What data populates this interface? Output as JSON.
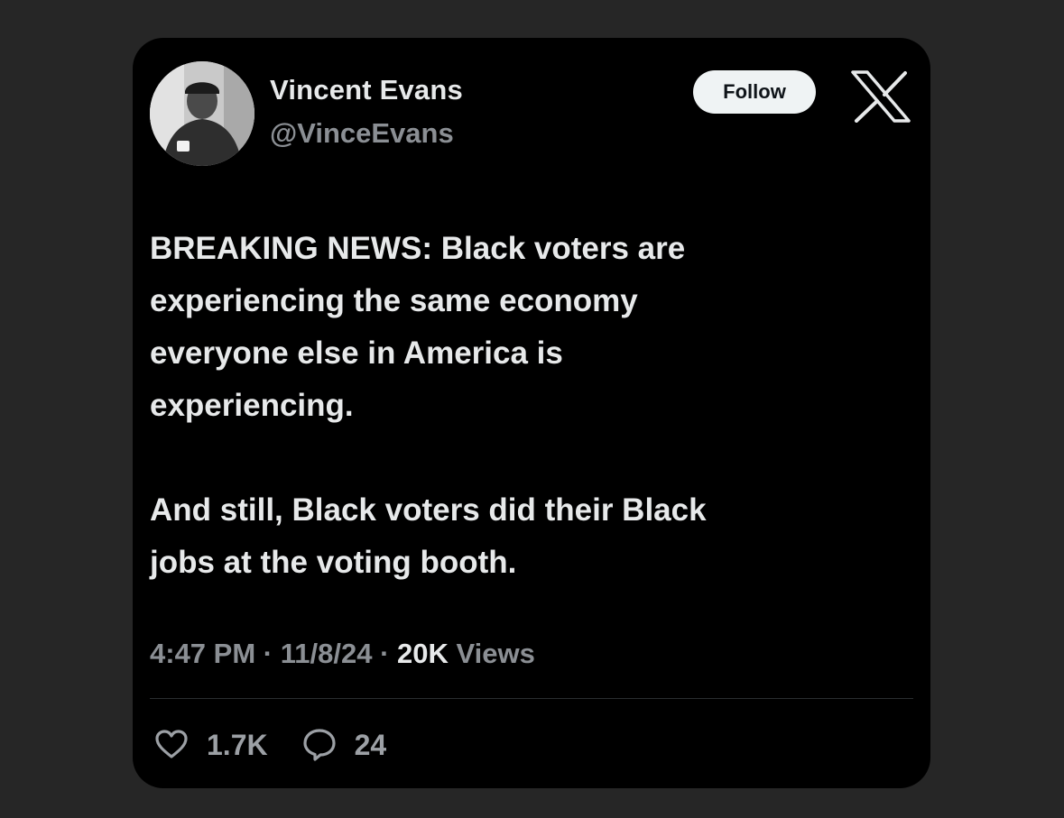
{
  "author": {
    "display_name": "Vincent Evans",
    "handle": "@VinceEvans"
  },
  "header": {
    "follow_label": "Follow",
    "brand_icon": "x-logo-icon"
  },
  "tweet": {
    "paragraphs": [
      "BREAKING NEWS: Black voters are\nexperiencing the same economy\neveryone else in America is\nexperiencing.",
      "And still, Black voters did their Black\njobs at the voting booth."
    ],
    "time": "4:47 PM",
    "separator": " · ",
    "date": "11/8/24",
    "views_count": "20K",
    "views_label": " Views"
  },
  "engagement": {
    "likes_icon": "heart-icon",
    "likes": "1.7K",
    "replies_icon": "reply-bubble-icon",
    "replies": "24"
  },
  "colors": {
    "page_background": "#262626",
    "card_background": "#000000",
    "primary_text": "#e7e9ea",
    "secondary_text": "#8b8f94",
    "follow_button_bg": "#eff3f4"
  }
}
